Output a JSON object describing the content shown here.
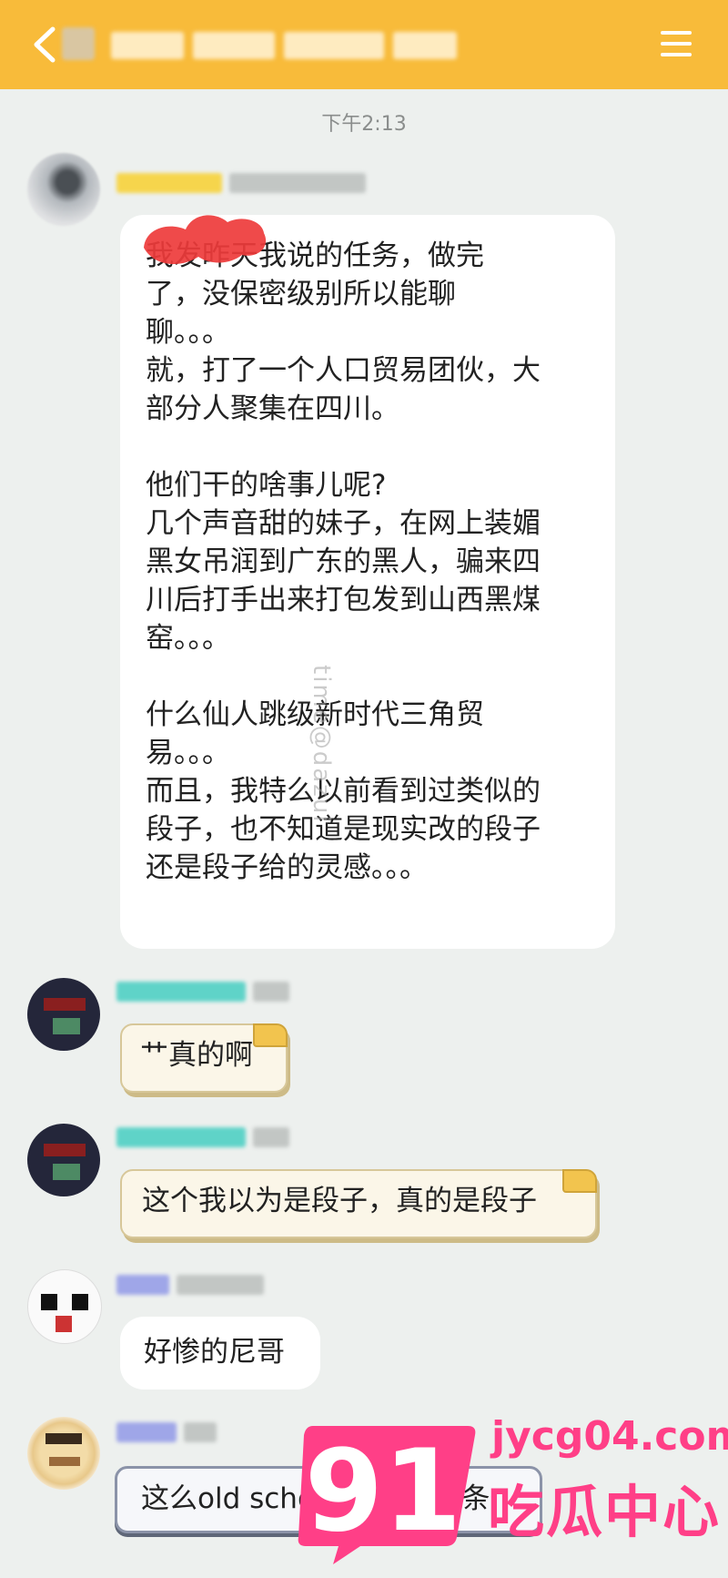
{
  "header": {
    "icons": {
      "back": "chevron-left-icon",
      "menu": "hamburger-menu-icon"
    },
    "colors": {
      "bar": "#f8bb3a"
    }
  },
  "chat": {
    "timestamp": "下午2:13",
    "messages": [
      {
        "avatar": "avatar-1",
        "text": "我发昨天我说的任务，做完\n了，没保密级别所以能聊\n聊。。。\n就，打了一个人口贸易团伙，大\n部分人聚集在四川。\n\n他们干的啥事儿呢?\n几个声音甜的妹子，在网上装媚\n黑女吊润到广东的黑人，骗来四\n川后打手出来打包发到山西黑煤\n窑。。。\n\n什么仙人跳级新时代三角贸\n易。。。\n而且，我特么以前看到过类似的\n段子，也不知道是现实改的段子\n还是段子给的灵感。。。"
      },
      {
        "avatar": "avatar-2",
        "text": "艹真的啊"
      },
      {
        "avatar": "avatar-2",
        "text": "这个我以为是段子，真的是段子"
      },
      {
        "avatar": "avatar-3",
        "text": "好惨的尼哥"
      },
      {
        "avatar": "avatar-4",
        "text": "这么old school 的贸易链条"
      }
    ]
  },
  "watermarks": {
    "vertical": "time@dazui",
    "logo_number": "91",
    "logo_domain": "jycg04.com",
    "logo_text": "吃瓜中心",
    "logo_color": "#ff3f87"
  }
}
